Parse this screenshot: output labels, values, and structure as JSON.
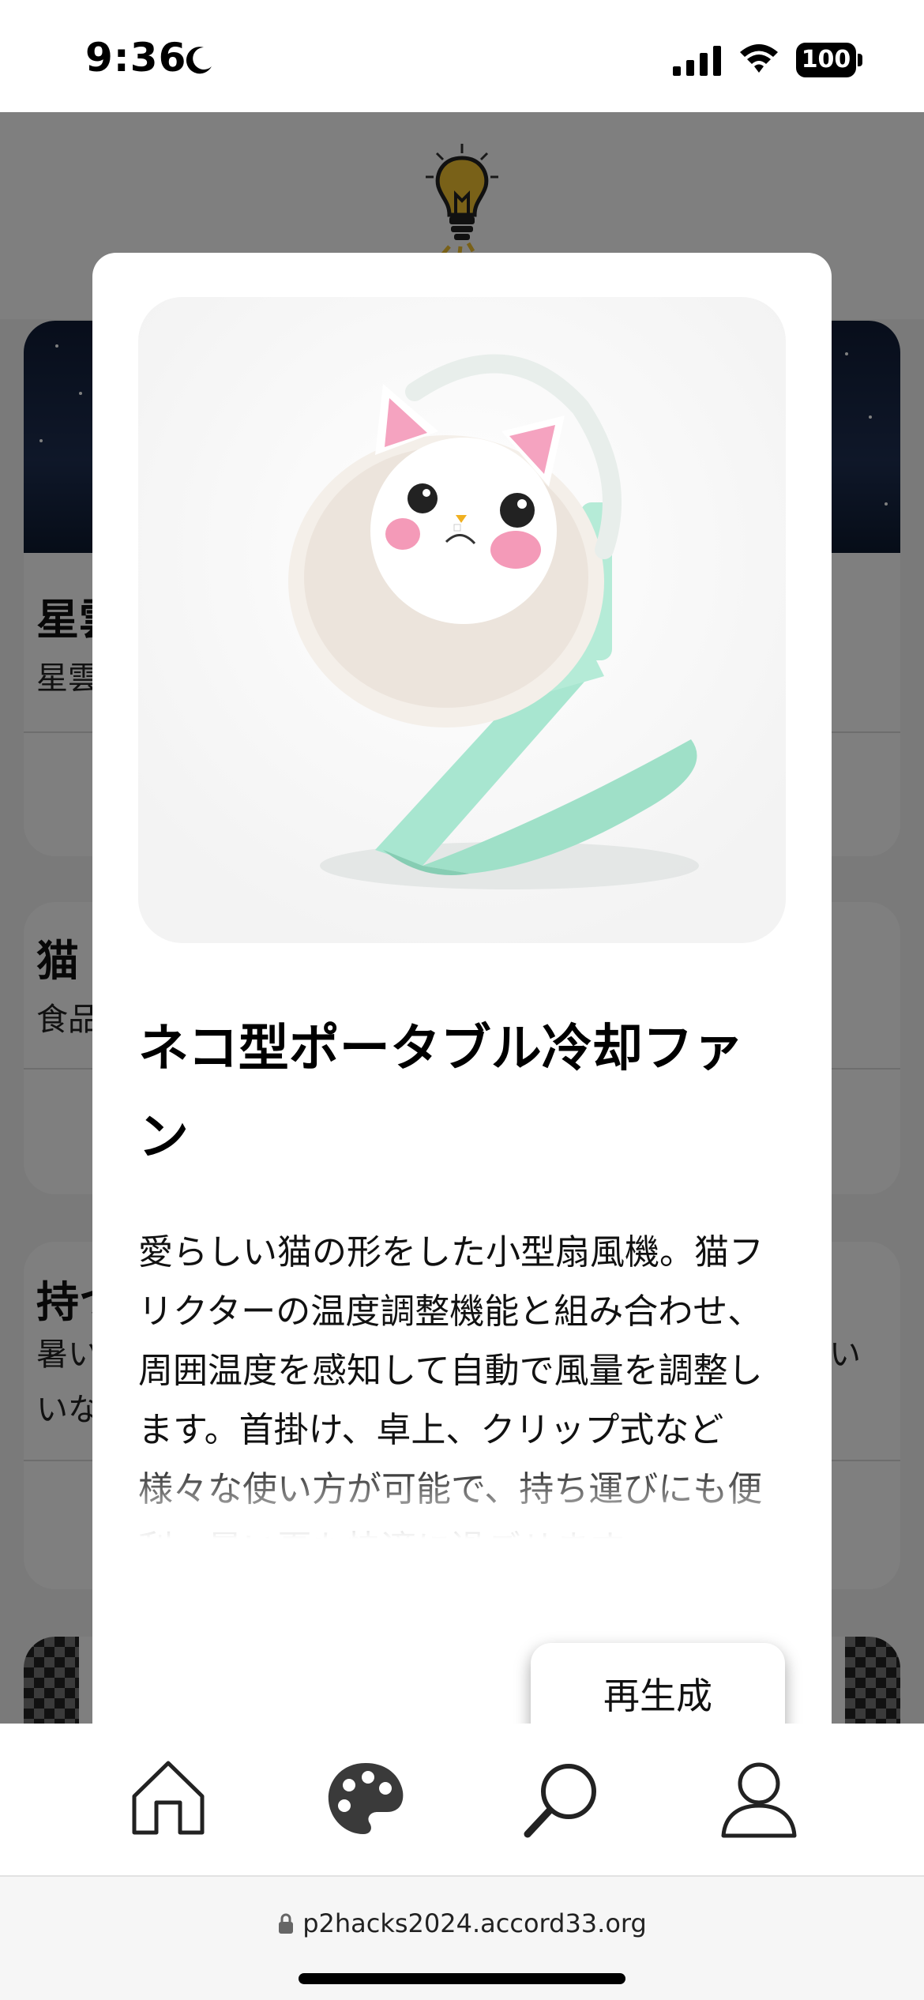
{
  "status_bar": {
    "time": "9:36",
    "battery": "100",
    "icons": [
      "moon-icon",
      "signal-icon",
      "wifi-icon",
      "battery-icon"
    ]
  },
  "background": {
    "cards": [
      {
        "title": "星雲",
        "subtitle": "星雲"
      },
      {
        "title": "猫",
        "subtitle": "食品"
      },
      {
        "title": "持つ",
        "subtitle_line1": "暑い",
        "subtitle_line2": "いな",
        "subtitle_right": "い"
      }
    ]
  },
  "modal": {
    "title": "ネコ型ポータブル冷却ファン",
    "description": "愛らしい猫の形をした小型扇風機。猫フリクターの温度調整機能と組み合わせ、周囲温度を感知して自動で風量を調整します。首掛け、卓上、クリップ式など様々な使い方が可能で、持ち運びにも便利。暑い夏も快適に過ごせます。",
    "regenerate_label": "再生成"
  },
  "bottom_nav": {
    "items": [
      {
        "icon": "home-icon"
      },
      {
        "icon": "palette-icon"
      },
      {
        "icon": "search-icon"
      },
      {
        "icon": "profile-icon"
      }
    ]
  },
  "browser": {
    "url": "p2hacks2024.accord33.org"
  },
  "colors": {
    "fan_mint": "#a8e6d0",
    "cat_pink": "#f5a3c0",
    "overlay": "rgba(0,0,0,0.5)"
  }
}
